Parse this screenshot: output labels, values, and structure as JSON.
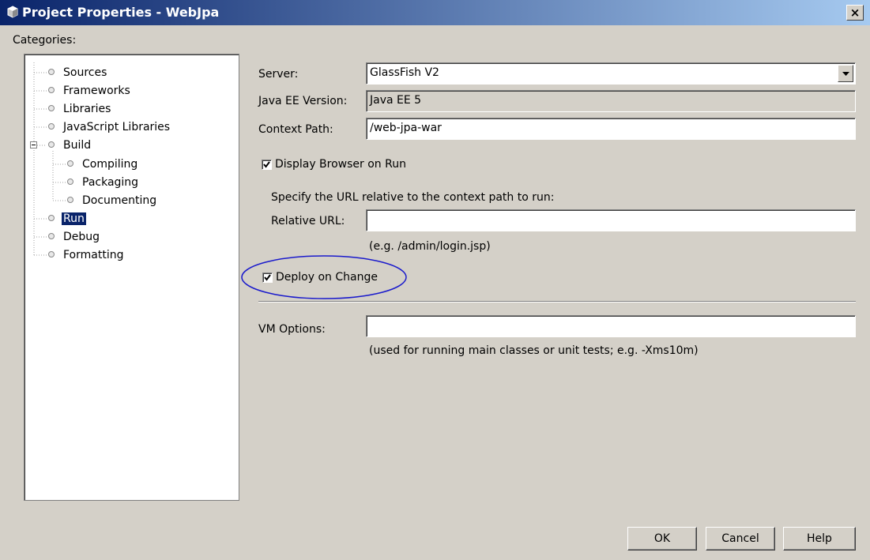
{
  "window": {
    "title": "Project Properties - WebJpa",
    "close_glyph": "×"
  },
  "categories": {
    "label": "Categories:",
    "items": [
      {
        "label": "Sources"
      },
      {
        "label": "Frameworks"
      },
      {
        "label": "Libraries"
      },
      {
        "label": "JavaScript Libraries"
      },
      {
        "label": "Build",
        "expander": "⊟"
      },
      {
        "label": "Compiling"
      },
      {
        "label": "Packaging"
      },
      {
        "label": "Documenting"
      },
      {
        "label": "Run",
        "selected": true
      },
      {
        "label": "Debug"
      },
      {
        "label": "Formatting"
      }
    ]
  },
  "form": {
    "server_label": "Server:",
    "server_value": "GlassFish V2",
    "javaee_label": "Java EE Version:",
    "javaee_value": "Java EE 5",
    "context_label": "Context Path:",
    "context_value": "/web-jpa-war",
    "display_browser_label": "Display Browser on Run",
    "display_browser_checked": true,
    "specify_text": "Specify the URL relative to the context path to run:",
    "relative_url_label": "Relative URL:",
    "relative_url_value": "",
    "relative_url_hint": "(e.g. /admin/login.jsp)",
    "deploy_label": "Deploy on Change",
    "deploy_checked": true,
    "vm_label": "VM Options:",
    "vm_value": "",
    "vm_hint": "(used for running main classes or unit tests; e.g. -Xms10m)"
  },
  "buttons": {
    "ok": "OK",
    "cancel": "Cancel",
    "help": "Help"
  },
  "colors": {
    "dialog_bg": "#d4d0c8",
    "title_bar": "#0a246a",
    "selection": "#0a246a",
    "highlight_ellipse": "#1a1acc"
  }
}
